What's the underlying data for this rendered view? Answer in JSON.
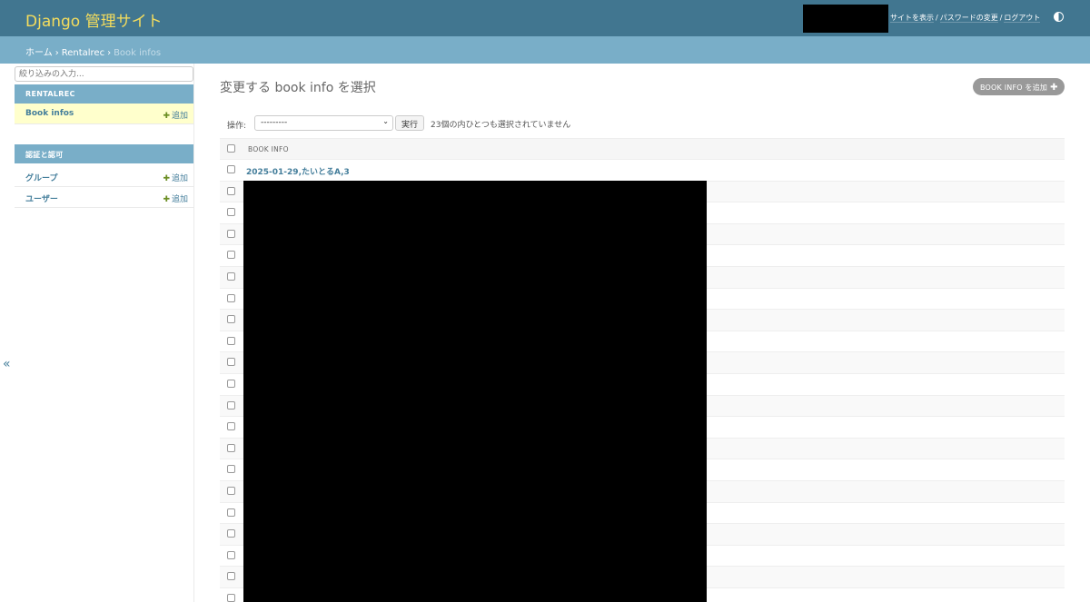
{
  "header": {
    "site_title": "Django 管理サイト",
    "user_tools": {
      "view_site": "サイトを表示",
      "change_password": "パスワードの変更",
      "logout": "ログアウト",
      "separator": "/"
    }
  },
  "breadcrumbs": {
    "home": "ホーム",
    "app": "Rentalrec",
    "current": "Book infos",
    "separator": "›"
  },
  "sidebar": {
    "filter_placeholder": "絞り込みの入力...",
    "apps": [
      {
        "caption": "RENTALREC",
        "models": [
          {
            "name": "Book infos",
            "add_label": "追加",
            "current": true
          }
        ]
      },
      {
        "caption": "認証と認可",
        "models": [
          {
            "name": "グループ",
            "add_label": "追加"
          },
          {
            "name": "ユーザー",
            "add_label": "追加"
          }
        ]
      }
    ],
    "toggle_label": "«"
  },
  "content": {
    "title": "変更する book info を選択",
    "add_button_label": "BOOK INFO を追加",
    "actions_label": "操作:",
    "action_select_value": "---------",
    "go_button_label": "実行",
    "selection_note": "23個の内ひとつも選択されていません",
    "column_header": "BOOK INFO",
    "rows": [
      "2025-01-29,たいとるA,3",
      "",
      "",
      "",
      "",
      "",
      "",
      "",
      "",
      "",
      "",
      "",
      "",
      "",
      "",
      "",
      "",
      "",
      "",
      "",
      ""
    ]
  },
  "icons": {
    "add": "plus-icon",
    "theme": "theme-toggle-icon",
    "select_caret": "chevron-down-icon"
  },
  "colors": {
    "header_bg": "#417690",
    "branding": "#f5dd5d",
    "breadcrumbs_bg": "#79aec8",
    "link": "#447e9b",
    "current_model_bg": "#ffffcc",
    "add_button_bg": "#999999"
  }
}
